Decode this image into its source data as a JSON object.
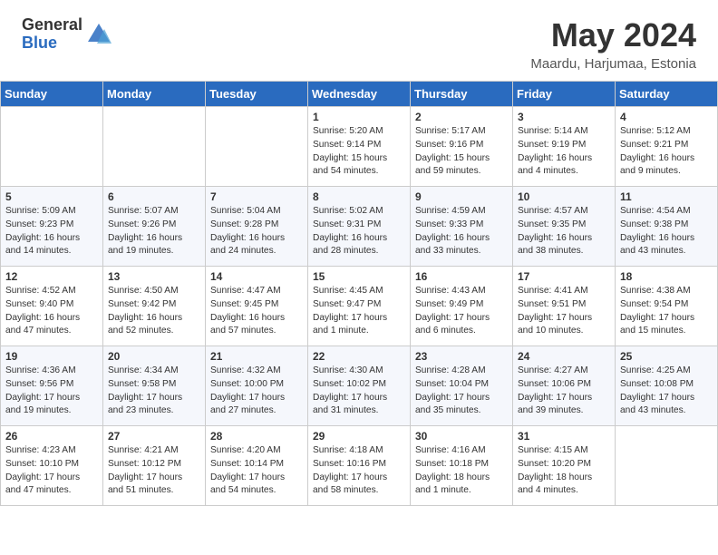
{
  "header": {
    "logo_general": "General",
    "logo_blue": "Blue",
    "month": "May 2024",
    "location": "Maardu, Harjumaa, Estonia"
  },
  "days_of_week": [
    "Sunday",
    "Monday",
    "Tuesday",
    "Wednesday",
    "Thursday",
    "Friday",
    "Saturday"
  ],
  "weeks": [
    [
      {
        "day": "",
        "info": ""
      },
      {
        "day": "",
        "info": ""
      },
      {
        "day": "",
        "info": ""
      },
      {
        "day": "1",
        "info": "Sunrise: 5:20 AM\nSunset: 9:14 PM\nDaylight: 15 hours\nand 54 minutes."
      },
      {
        "day": "2",
        "info": "Sunrise: 5:17 AM\nSunset: 9:16 PM\nDaylight: 15 hours\nand 59 minutes."
      },
      {
        "day": "3",
        "info": "Sunrise: 5:14 AM\nSunset: 9:19 PM\nDaylight: 16 hours\nand 4 minutes."
      },
      {
        "day": "4",
        "info": "Sunrise: 5:12 AM\nSunset: 9:21 PM\nDaylight: 16 hours\nand 9 minutes."
      }
    ],
    [
      {
        "day": "5",
        "info": "Sunrise: 5:09 AM\nSunset: 9:23 PM\nDaylight: 16 hours\nand 14 minutes."
      },
      {
        "day": "6",
        "info": "Sunrise: 5:07 AM\nSunset: 9:26 PM\nDaylight: 16 hours\nand 19 minutes."
      },
      {
        "day": "7",
        "info": "Sunrise: 5:04 AM\nSunset: 9:28 PM\nDaylight: 16 hours\nand 24 minutes."
      },
      {
        "day": "8",
        "info": "Sunrise: 5:02 AM\nSunset: 9:31 PM\nDaylight: 16 hours\nand 28 minutes."
      },
      {
        "day": "9",
        "info": "Sunrise: 4:59 AM\nSunset: 9:33 PM\nDaylight: 16 hours\nand 33 minutes."
      },
      {
        "day": "10",
        "info": "Sunrise: 4:57 AM\nSunset: 9:35 PM\nDaylight: 16 hours\nand 38 minutes."
      },
      {
        "day": "11",
        "info": "Sunrise: 4:54 AM\nSunset: 9:38 PM\nDaylight: 16 hours\nand 43 minutes."
      }
    ],
    [
      {
        "day": "12",
        "info": "Sunrise: 4:52 AM\nSunset: 9:40 PM\nDaylight: 16 hours\nand 47 minutes."
      },
      {
        "day": "13",
        "info": "Sunrise: 4:50 AM\nSunset: 9:42 PM\nDaylight: 16 hours\nand 52 minutes."
      },
      {
        "day": "14",
        "info": "Sunrise: 4:47 AM\nSunset: 9:45 PM\nDaylight: 16 hours\nand 57 minutes."
      },
      {
        "day": "15",
        "info": "Sunrise: 4:45 AM\nSunset: 9:47 PM\nDaylight: 17 hours\nand 1 minute."
      },
      {
        "day": "16",
        "info": "Sunrise: 4:43 AM\nSunset: 9:49 PM\nDaylight: 17 hours\nand 6 minutes."
      },
      {
        "day": "17",
        "info": "Sunrise: 4:41 AM\nSunset: 9:51 PM\nDaylight: 17 hours\nand 10 minutes."
      },
      {
        "day": "18",
        "info": "Sunrise: 4:38 AM\nSunset: 9:54 PM\nDaylight: 17 hours\nand 15 minutes."
      }
    ],
    [
      {
        "day": "19",
        "info": "Sunrise: 4:36 AM\nSunset: 9:56 PM\nDaylight: 17 hours\nand 19 minutes."
      },
      {
        "day": "20",
        "info": "Sunrise: 4:34 AM\nSunset: 9:58 PM\nDaylight: 17 hours\nand 23 minutes."
      },
      {
        "day": "21",
        "info": "Sunrise: 4:32 AM\nSunset: 10:00 PM\nDaylight: 17 hours\nand 27 minutes."
      },
      {
        "day": "22",
        "info": "Sunrise: 4:30 AM\nSunset: 10:02 PM\nDaylight: 17 hours\nand 31 minutes."
      },
      {
        "day": "23",
        "info": "Sunrise: 4:28 AM\nSunset: 10:04 PM\nDaylight: 17 hours\nand 35 minutes."
      },
      {
        "day": "24",
        "info": "Sunrise: 4:27 AM\nSunset: 10:06 PM\nDaylight: 17 hours\nand 39 minutes."
      },
      {
        "day": "25",
        "info": "Sunrise: 4:25 AM\nSunset: 10:08 PM\nDaylight: 17 hours\nand 43 minutes."
      }
    ],
    [
      {
        "day": "26",
        "info": "Sunrise: 4:23 AM\nSunset: 10:10 PM\nDaylight: 17 hours\nand 47 minutes."
      },
      {
        "day": "27",
        "info": "Sunrise: 4:21 AM\nSunset: 10:12 PM\nDaylight: 17 hours\nand 51 minutes."
      },
      {
        "day": "28",
        "info": "Sunrise: 4:20 AM\nSunset: 10:14 PM\nDaylight: 17 hours\nand 54 minutes."
      },
      {
        "day": "29",
        "info": "Sunrise: 4:18 AM\nSunset: 10:16 PM\nDaylight: 17 hours\nand 58 minutes."
      },
      {
        "day": "30",
        "info": "Sunrise: 4:16 AM\nSunset: 10:18 PM\nDaylight: 18 hours\nand 1 minute."
      },
      {
        "day": "31",
        "info": "Sunrise: 4:15 AM\nSunset: 10:20 PM\nDaylight: 18 hours\nand 4 minutes."
      },
      {
        "day": "",
        "info": ""
      }
    ]
  ]
}
